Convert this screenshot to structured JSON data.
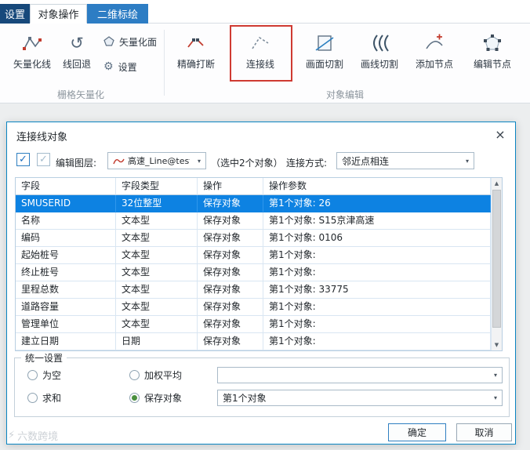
{
  "tabs": [
    {
      "label": "设置"
    },
    {
      "label": "对象操作"
    },
    {
      "label": "二维标绘"
    }
  ],
  "ribbon": {
    "groups": [
      {
        "label": "栅格矢量化",
        "buttons": [
          {
            "label": "矢量化线"
          },
          {
            "label": "线回退"
          },
          {
            "label": "矢量化面"
          },
          {
            "label": "设置"
          }
        ]
      },
      {
        "label": "对象编辑",
        "buttons": [
          {
            "label": "精确打断"
          },
          {
            "label": "连接线",
            "highlighted": true
          },
          {
            "label": "画面切割"
          },
          {
            "label": "画线切割"
          },
          {
            "label": "添加节点"
          },
          {
            "label": "编辑节点"
          }
        ]
      }
    ]
  },
  "dialog": {
    "title": "连接线对象",
    "edit_layer_label": "编辑图层:",
    "layer_combo_value": "高速_Line@test",
    "selection_info": "（选中2个对象）",
    "connect_method_label": "连接方式:",
    "connect_method_value": "邻近点相连",
    "table": {
      "columns": [
        "字段",
        "字段类型",
        "操作",
        "操作参数"
      ],
      "rows": [
        {
          "field": "SMUSERID",
          "type": "32位整型",
          "op": "保存对象",
          "param": "第1个对象: 26",
          "selected": true
        },
        {
          "field": "名称",
          "type": "文本型",
          "op": "保存对象",
          "param": "第1个对象: S15京津高速",
          "selected": false
        },
        {
          "field": "编码",
          "type": "文本型",
          "op": "保存对象",
          "param": "第1个对象: 0106",
          "selected": false
        },
        {
          "field": "起始桩号",
          "type": "文本型",
          "op": "保存对象",
          "param": "第1个对象:",
          "selected": false
        },
        {
          "field": "终止桩号",
          "type": "文本型",
          "op": "保存对象",
          "param": "第1个对象:",
          "selected": false
        },
        {
          "field": "里程总数",
          "type": "文本型",
          "op": "保存对象",
          "param": "第1个对象: 33775",
          "selected": false
        },
        {
          "field": "道路容量",
          "type": "文本型",
          "op": "保存对象",
          "param": "第1个对象:",
          "selected": false
        },
        {
          "field": "管理单位",
          "type": "文本型",
          "op": "保存对象",
          "param": "第1个对象:",
          "selected": false
        },
        {
          "field": "建立日期",
          "type": "日期",
          "op": "保存对象",
          "param": "第1个对象:",
          "selected": false
        }
      ]
    },
    "unified": {
      "title": "统一设置",
      "options": [
        {
          "label": "为空",
          "checked": false
        },
        {
          "label": "加权平均",
          "checked": false
        },
        {
          "label": "求和",
          "checked": false
        },
        {
          "label": "保存对象",
          "checked": true
        }
      ],
      "combo_top_value": "",
      "combo_bottom_value": "第1个对象"
    },
    "ok_label": "确定",
    "cancel_label": "取消"
  },
  "icons": {
    "check": "✓",
    "chevron_down": "▾",
    "close": "×",
    "scroll_up": "▲",
    "scroll_down": "▼",
    "lightning": "⚡",
    "undo": "↺",
    "gear": "⚙"
  },
  "watermark": "六数跨境"
}
